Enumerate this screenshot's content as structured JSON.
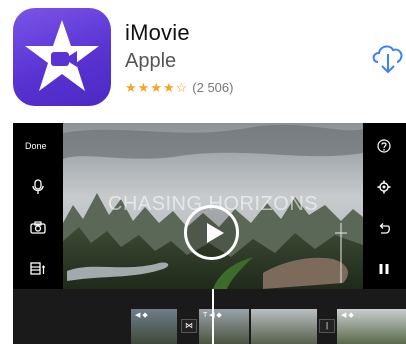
{
  "app": {
    "name": "iMovie",
    "developer": "Apple",
    "rating": 4.5,
    "rating_count": "(2 506)",
    "icon": "imovie-star-camera-icon",
    "download_icon": "cloud-download-icon"
  },
  "preview": {
    "done_label": "Done",
    "video_title": "CHASING HORIZONS",
    "left_tools": [
      "microphone-icon",
      "camera-icon",
      "clips-icon"
    ],
    "right_tools": [
      "help-icon",
      "settings-icon",
      "undo-icon",
      "pause-icon"
    ],
    "timeline": {
      "transitions": [
        "transition-icon",
        "title-icon",
        "transition-icon"
      ]
    }
  },
  "colors": {
    "icon_purple": "#5a33d2",
    "star": "#f5a623"
  }
}
